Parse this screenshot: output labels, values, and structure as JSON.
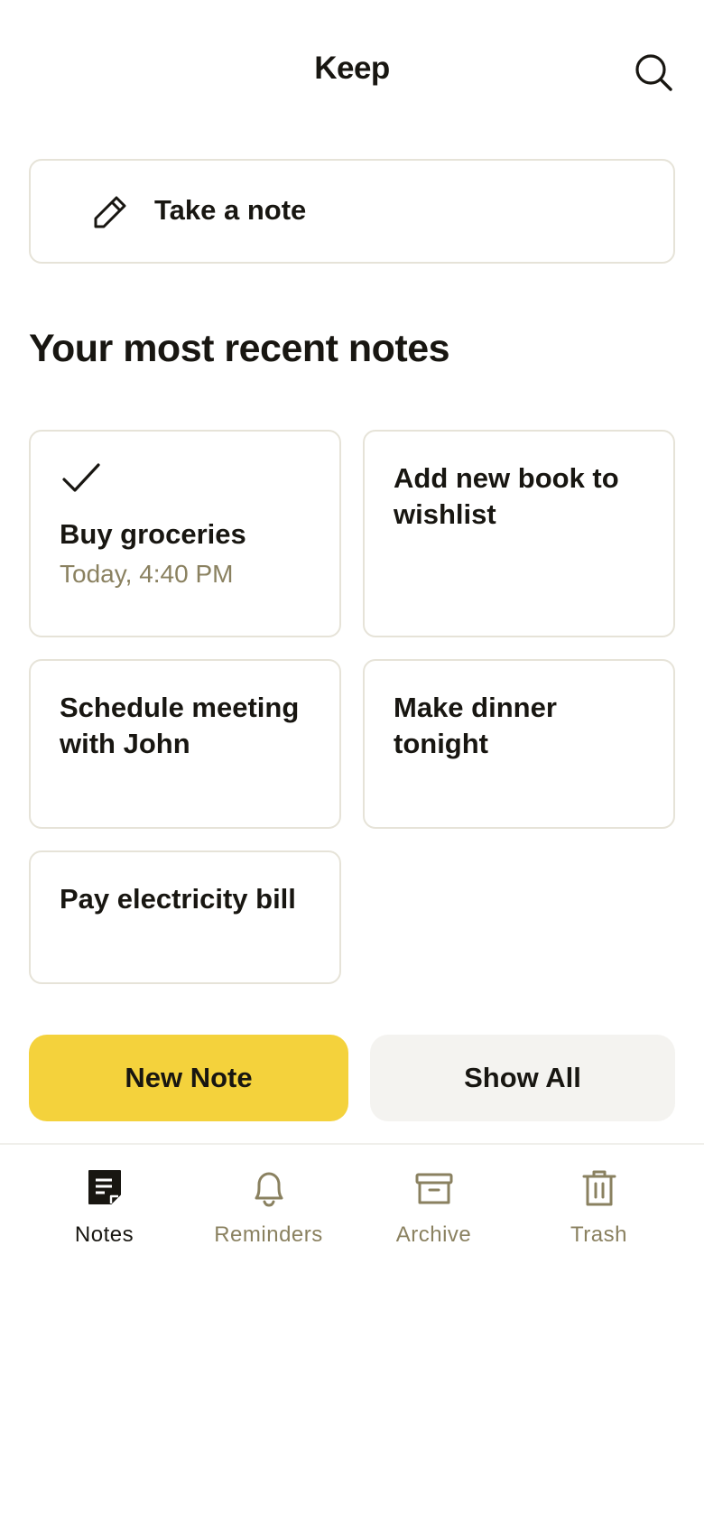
{
  "header": {
    "title": "Keep",
    "search_icon": "search-icon"
  },
  "composer": {
    "label": "Take a note",
    "icon": "pencil-icon"
  },
  "recent": {
    "title": "Your most recent notes",
    "notes": [
      {
        "title": "Buy groceries",
        "time": "Today, 4:40 PM",
        "checked": true,
        "icon": "check-icon"
      },
      {
        "title": "Add new book to wishlist"
      },
      {
        "title": "Schedule meeting with John"
      },
      {
        "title": "Make dinner tonight"
      },
      {
        "title": "Pay electricity bill"
      }
    ]
  },
  "actions": {
    "new_note_label": "New Note",
    "show_all_label": "Show All"
  },
  "nav": {
    "items": [
      {
        "label": "Notes",
        "icon": "note-icon",
        "active": true
      },
      {
        "label": "Reminders",
        "icon": "bell-icon",
        "active": false
      },
      {
        "label": "Archive",
        "icon": "archive-icon",
        "active": false
      },
      {
        "label": "Trash",
        "icon": "trash-icon",
        "active": false
      }
    ]
  },
  "colors": {
    "accent": "#f4d23c",
    "text": "#181611",
    "muted": "#8a8160",
    "border": "#e6e3d8",
    "secondary_button": "#f4f3f0"
  }
}
